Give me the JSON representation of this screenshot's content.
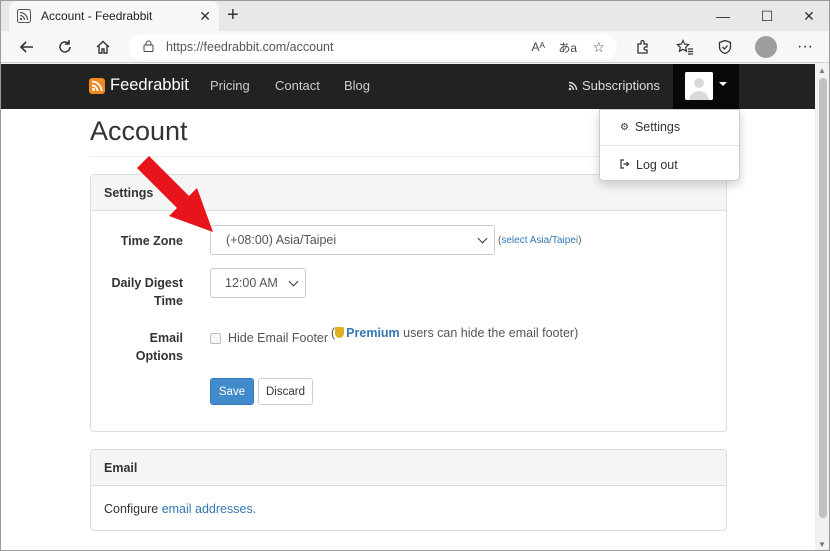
{
  "browser": {
    "tab_title": "Account - Feedrabbit",
    "new_tab": "+",
    "url": "https://feedrabbit.com/account",
    "read_aloud": "Aᴬ",
    "translate": "あa"
  },
  "navbar": {
    "brand": "Feedrabbit",
    "links": [
      "Pricing",
      "Contact",
      "Blog"
    ],
    "subscriptions": "Subscriptions"
  },
  "dropdown": {
    "settings": "Settings",
    "logout": "Log out"
  },
  "page": {
    "title": "Account"
  },
  "settings_panel": {
    "heading": "Settings",
    "timezone_label": "Time Zone",
    "timezone_value": "(+08:00) Asia/Taipei",
    "timezone_hint_open": "(",
    "timezone_hint_link": "select Asia/Taipei",
    "timezone_hint_close": ")",
    "digest_label_1": "Daily Digest",
    "digest_label_2": "Time",
    "digest_value": "12:00 AM",
    "email_options_label_1": "Email",
    "email_options_label_2": "Options",
    "hide_footer_label": "Hide Email Footer",
    "premium_open": "(",
    "premium_word": "Premium",
    "premium_text": " users can hide the email footer)",
    "save": "Save",
    "discard": "Discard"
  },
  "email_panel": {
    "heading": "Email",
    "text": "Configure ",
    "link": "email addresses."
  },
  "colors": {
    "navbar": "#222222",
    "primary": "#428bca",
    "link": "#337ab7",
    "brand_icon": "#f0891e",
    "annotation_arrow": "#e8141c"
  }
}
